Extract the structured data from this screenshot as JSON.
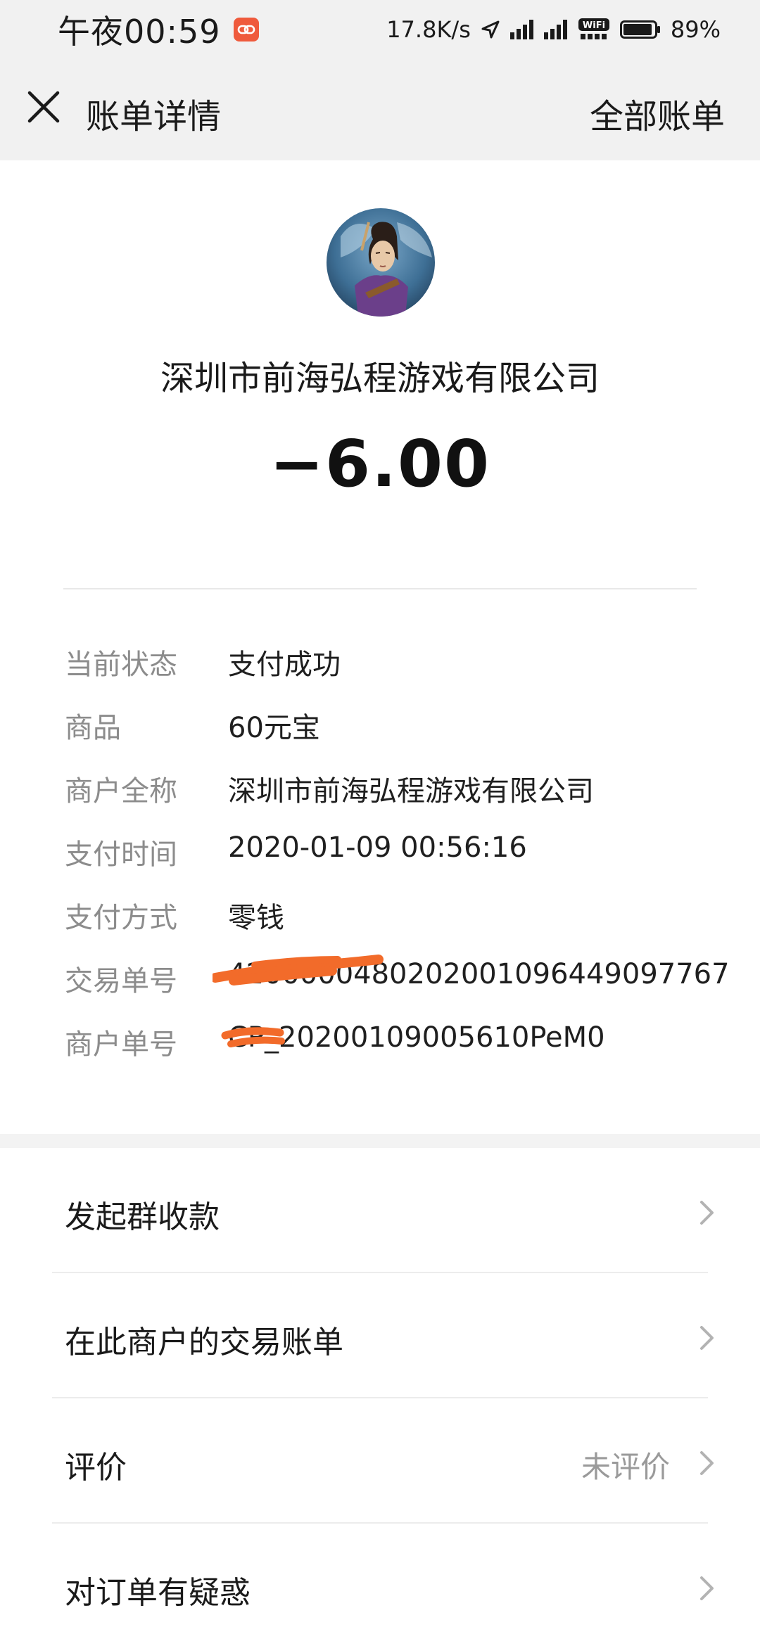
{
  "status_bar": {
    "time": "午夜00:59",
    "speed": "17.8K/s",
    "battery": "89%"
  },
  "nav": {
    "title": "账单详情",
    "right_link": "全部账单"
  },
  "header": {
    "merchant_name": "深圳市前海弘程游戏有限公司",
    "amount": "−6.00"
  },
  "details": [
    {
      "label": "当前状态",
      "value": "支付成功"
    },
    {
      "label": "商品",
      "value": "60元宝"
    },
    {
      "label": "商户全称",
      "value": "深圳市前海弘程游戏有限公司"
    },
    {
      "label": "支付时间",
      "value": "2020-01-09 00:56:16"
    },
    {
      "label": "支付方式",
      "value": "零钱"
    },
    {
      "label": "交易单号",
      "value": "4200000480202001096449097767"
    },
    {
      "label": "商户单号",
      "value": "CP_20200109005610PeM0"
    }
  ],
  "actions": [
    {
      "label": "发起群收款",
      "status": ""
    },
    {
      "label": "在此商户的交易账单",
      "status": ""
    },
    {
      "label": "评价",
      "status": "未评价"
    },
    {
      "label": "对订单有疑惑",
      "status": ""
    }
  ],
  "colors": {
    "bar_bg": "#f1f1f1",
    "label_gray": "#8c8c8c",
    "redaction": "#f26b2a"
  }
}
